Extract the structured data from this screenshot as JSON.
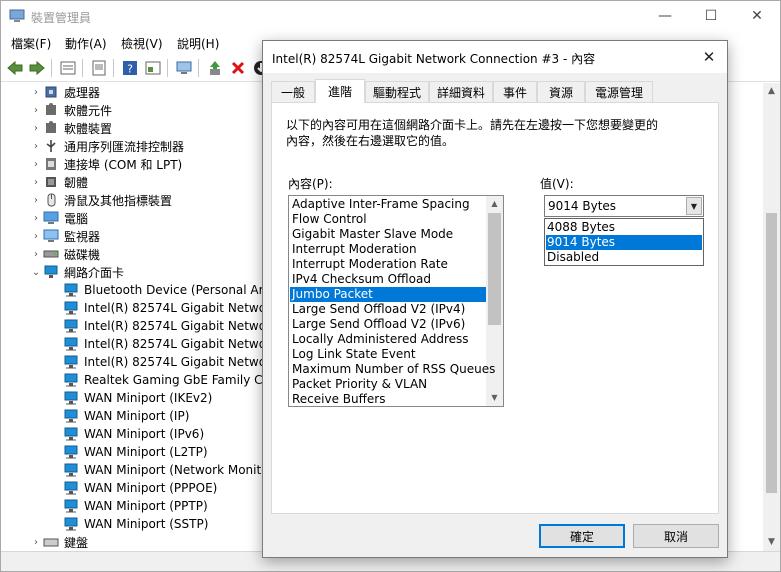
{
  "window": {
    "title": "裝置管理員",
    "minimize": "—",
    "maximize": "☐",
    "close": "✕"
  },
  "menu": [
    "檔案(F)",
    "動作(A)",
    "檢視(V)",
    "說明(H)"
  ],
  "toolbar_icons": [
    "back-arrow-icon",
    "forward-arrow-icon",
    "properties-icon",
    "help-icon",
    "show-hidden-icon",
    "monitor-icon",
    "update-driver-icon",
    "uninstall-x-icon",
    "download-icon"
  ],
  "tree": [
    {
      "label": "處理器",
      "icon": "cpu-icon",
      "level": 1,
      "expand": "›"
    },
    {
      "label": "軟體元件",
      "icon": "puzzle-icon",
      "level": 1,
      "expand": "›"
    },
    {
      "label": "軟體裝置",
      "icon": "puzzle-icon",
      "level": 1,
      "expand": "›"
    },
    {
      "label": "通用序列匯流排控制器",
      "icon": "usb-icon",
      "level": 1,
      "expand": "›"
    },
    {
      "label": "連接埠 (COM 和 LPT)",
      "icon": "port-icon",
      "level": 1,
      "expand": "›"
    },
    {
      "label": "韌體",
      "icon": "chip-icon",
      "level": 1,
      "expand": "›"
    },
    {
      "label": "滑鼠及其他指標裝置",
      "icon": "mouse-icon",
      "level": 1,
      "expand": "›"
    },
    {
      "label": "電腦",
      "icon": "computer-icon",
      "level": 1,
      "expand": "›"
    },
    {
      "label": "監視器",
      "icon": "monitor-icon",
      "level": 1,
      "expand": "›"
    },
    {
      "label": "磁碟機",
      "icon": "disk-icon",
      "level": 1,
      "expand": "›"
    },
    {
      "label": "網路介面卡",
      "icon": "network-icon",
      "level": 1,
      "expand": "⌄"
    },
    {
      "label": "Bluetooth Device (Personal Area",
      "icon": "network-adapter-icon",
      "level": 2,
      "expand": ""
    },
    {
      "label": "Intel(R) 82574L Gigabit Network",
      "icon": "network-adapter-icon",
      "level": 2,
      "expand": ""
    },
    {
      "label": "Intel(R) 82574L Gigabit Network",
      "icon": "network-adapter-icon",
      "level": 2,
      "expand": ""
    },
    {
      "label": "Intel(R) 82574L Gigabit Network",
      "icon": "network-adapter-icon",
      "level": 2,
      "expand": ""
    },
    {
      "label": "Intel(R) 82574L Gigabit Network",
      "icon": "network-adapter-icon",
      "level": 2,
      "expand": ""
    },
    {
      "label": "Realtek Gaming GbE Family Cor",
      "icon": "network-adapter-icon",
      "level": 2,
      "expand": ""
    },
    {
      "label": "WAN Miniport (IKEv2)",
      "icon": "network-adapter-icon",
      "level": 2,
      "expand": ""
    },
    {
      "label": "WAN Miniport (IP)",
      "icon": "network-adapter-icon",
      "level": 2,
      "expand": ""
    },
    {
      "label": "WAN Miniport (IPv6)",
      "icon": "network-adapter-icon",
      "level": 2,
      "expand": ""
    },
    {
      "label": "WAN Miniport (L2TP)",
      "icon": "network-adapter-icon",
      "level": 2,
      "expand": ""
    },
    {
      "label": "WAN Miniport (Network Monito",
      "icon": "network-adapter-icon",
      "level": 2,
      "expand": ""
    },
    {
      "label": "WAN Miniport (PPPOE)",
      "icon": "network-adapter-icon",
      "level": 2,
      "expand": ""
    },
    {
      "label": "WAN Miniport (PPTP)",
      "icon": "network-adapter-icon",
      "level": 2,
      "expand": ""
    },
    {
      "label": "WAN Miniport (SSTP)",
      "icon": "network-adapter-icon",
      "level": 2,
      "expand": ""
    },
    {
      "label": "鍵盤",
      "icon": "keyboard-icon",
      "level": 1,
      "expand": "›"
    }
  ],
  "dialog": {
    "title": "Intel(R) 82574L Gigabit Network Connection #3 - 內容",
    "close": "✕",
    "tabs": [
      {
        "label": "一般",
        "active": false
      },
      {
        "label": "進階",
        "active": true
      },
      {
        "label": "驅動程式",
        "active": false
      },
      {
        "label": "詳細資料",
        "active": false
      },
      {
        "label": "事件",
        "active": false
      },
      {
        "label": "資源",
        "active": false
      },
      {
        "label": "電源管理",
        "active": false
      }
    ],
    "description_line1": "以下的內容可用在這個網路介面卡上。請先在左邊按一下您想要變更的",
    "description_line2": "內容，然後在右邊選取它的值。",
    "property_label": "內容(P):",
    "value_label": "值(V):",
    "properties": [
      "Adaptive Inter-Frame Spacing",
      "Flow Control",
      "Gigabit Master Slave Mode",
      "Interrupt Moderation",
      "Interrupt Moderation Rate",
      "IPv4 Checksum Offload",
      "Jumbo Packet",
      "Large Send Offload V2 (IPv4)",
      "Large Send Offload V2 (IPv6)",
      "Locally Administered Address",
      "Log Link State Event",
      "Maximum Number of RSS Queues",
      "Packet Priority & VLAN",
      "Receive Buffers"
    ],
    "selected_property": "Jumbo Packet",
    "current_value": "9014 Bytes",
    "value_options": [
      "4088 Bytes",
      "9014 Bytes",
      "Disabled"
    ],
    "selected_option": "9014 Bytes",
    "ok_label": "確定",
    "cancel_label": "取消"
  },
  "colors": {
    "selection": "#0078d7",
    "network_icon": "#1e8fd6"
  }
}
